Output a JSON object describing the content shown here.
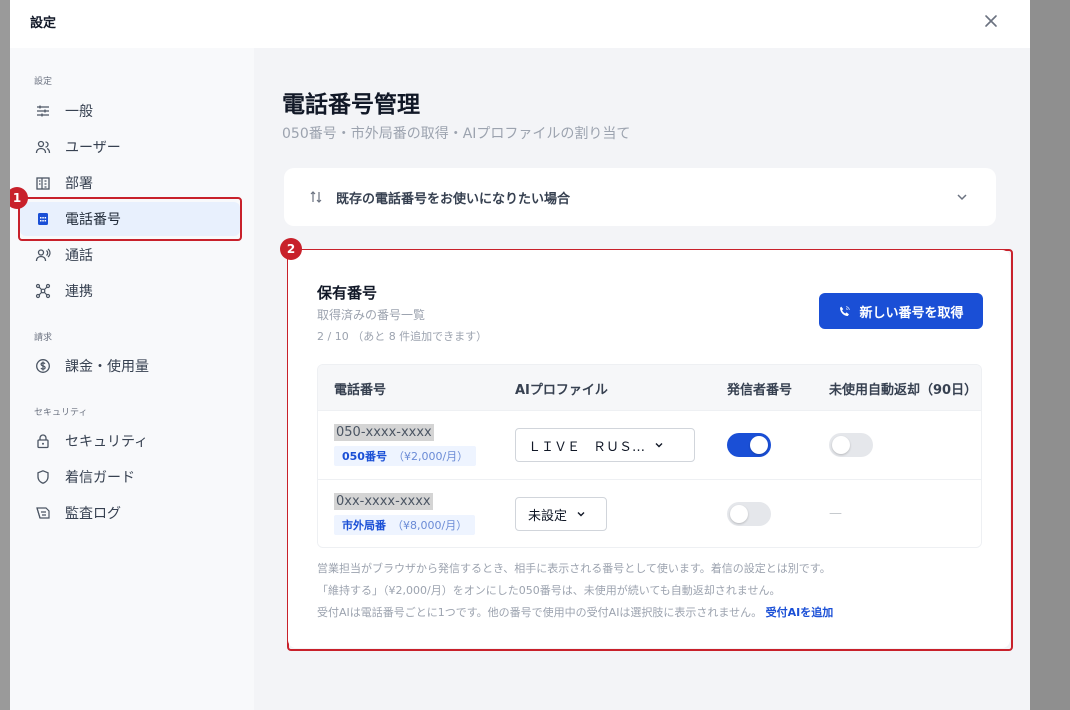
{
  "modal": {
    "title": "設定",
    "close_icon": "close-icon"
  },
  "sidebar": {
    "sections": [
      {
        "label": "設定"
      },
      {
        "label": "請求"
      },
      {
        "label": "セキュリティ"
      }
    ],
    "items": [
      {
        "label": "一般",
        "icon": "sliders-icon"
      },
      {
        "label": "ユーザー",
        "icon": "users-icon"
      },
      {
        "label": "部署",
        "icon": "building-icon"
      },
      {
        "label": "電話番号",
        "icon": "phone-book-icon",
        "active": true
      },
      {
        "label": "通話",
        "icon": "voice-icon"
      },
      {
        "label": "連携",
        "icon": "network-icon"
      },
      {
        "label": "課金・使用量",
        "icon": "dollar-icon"
      },
      {
        "label": "セキュリティ",
        "icon": "lock-icon"
      },
      {
        "label": "着信ガード",
        "icon": "shield-icon"
      },
      {
        "label": "監査ログ",
        "icon": "log-icon"
      }
    ]
  },
  "annotations": {
    "one": "1",
    "two": "2",
    "color": "#c8212b"
  },
  "main": {
    "title": "電話番号管理",
    "subtitle": "050番号・市外局番の取得・AIプロファイルの割り当て",
    "accordion": {
      "label": "既存の電話番号をお使いになりたい場合",
      "icon": "transfer-arrows-icon"
    },
    "card": {
      "title": "保有番号",
      "subtitle": "取得済みの番号一覧",
      "count": "2 / 10 （あと 8 件追加できます）",
      "new_button": "新しい番号を取得",
      "columns": [
        "電話番号",
        "AIプロファイル",
        "発信者番号",
        "未使用自動返却（90日）"
      ],
      "rows": [
        {
          "number": "050-xxxx-xxxx",
          "type": "050番号",
          "price": "（¥2,000/月）",
          "profile": "ＬＩＶＥ　ＲＵＳ…",
          "caller_id": true,
          "auto_return": "off"
        },
        {
          "number": "0xx-xxxx-xxxx",
          "type": "市外局番",
          "price": "（¥8,000/月）",
          "profile": "未設定",
          "caller_id": false,
          "auto_return": "—"
        }
      ],
      "notes": [
        "営業担当がブラウザから発信するとき、相手に表示される番号として使います。着信の設定とは別です。",
        "「維持する」（¥2,000/月）をオンにした050番号は、未使用が続いても自動返却されません。",
        "受付AIは電話番号ごとに1つです。他の番号で使用中の受付AIは選択肢に表示されません。"
      ],
      "add_link": "受付AIを追加"
    }
  },
  "colors": {
    "primary": "#1a4fd6",
    "active_bg": "#e8f0fd",
    "annotation": "#c8212b"
  }
}
